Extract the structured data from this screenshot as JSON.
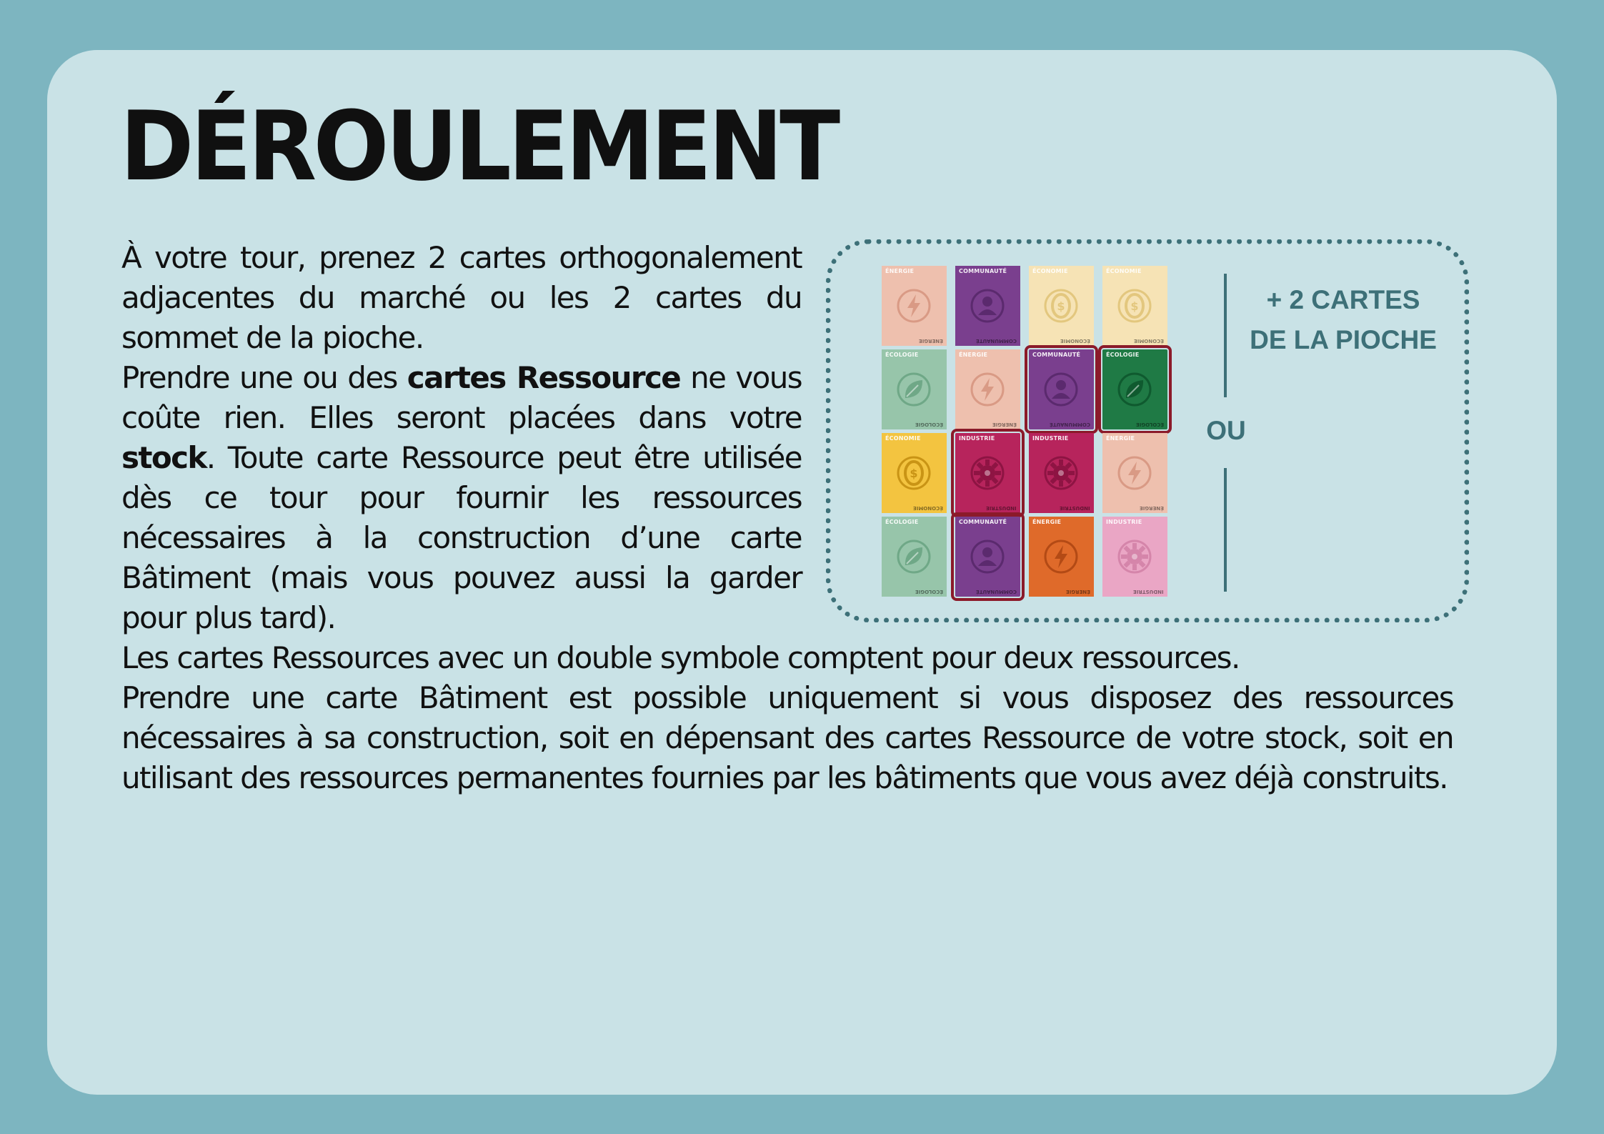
{
  "title": "DÉROULEMENT",
  "paragraph1": {
    "s1": "À votre tour, prenez 2 cartes orthogonalement adjacentes du marché ou les 2 cartes du sommet de la pioche.",
    "s2a": "Prendre une ou des ",
    "s2b": "cartes Ressource",
    "s2c": " ne vous coûte rien. Elles seront placées dans votre ",
    "s2d": "stock",
    "s2e": ". Toute carte Ressource peut être utilisée dès ce tour pour fournir les ressources nécessaires à la construction d’une carte Bâtiment (mais vous pouvez aussi la garder pour plus tard)."
  },
  "paragraph2": {
    "s1": "Les cartes Ressources avec un double symbole comptent pour deux ressources.",
    "s2": "Prendre une carte Bâtiment est possible uniquement si vous disposez des ressources nécessaires à sa construction, soit en dépensant des cartes Ressource de votre stock, soit en utilisant des ressources permanentes fournies par les bâtiments que vous avez déjà construits."
  },
  "diagram": {
    "or_label": "OU",
    "draw_label_line1": "+ 2 CARTES",
    "draw_label_line2": "DE LA PIOCHE",
    "cards": [
      {
        "label": "ÉNERGIE",
        "icon": "lightning-icon",
        "bg": "#eec0ae",
        "fg": "#d99a85",
        "selected": false
      },
      {
        "label": "COMMUNAUTÉ",
        "icon": "person-icon",
        "bg": "#7a3f8e",
        "fg": "#5b2a6e",
        "selected": false
      },
      {
        "label": "ÉCONOMIE",
        "icon": "coin-icon",
        "bg": "#f6e3b5",
        "fg": "#e3c77e",
        "selected": false
      },
      {
        "label": "ÉCONOMIE",
        "icon": "coin-icon",
        "bg": "#f6e3b5",
        "fg": "#e3c77e",
        "selected": false
      },
      {
        "label": "ÉCOLOGIE",
        "icon": "leaf-icon",
        "bg": "#97c5aa",
        "fg": "#6fa887",
        "selected": false
      },
      {
        "label": "ÉNERGIE",
        "icon": "lightning-icon",
        "bg": "#eec0ae",
        "fg": "#d99a85",
        "selected": false
      },
      {
        "label": "COMMUNAUTÉ",
        "icon": "person-icon",
        "bg": "#7a3f8e",
        "fg": "#5b2a6e",
        "selected": true
      },
      {
        "label": "ÉCOLOGIE",
        "icon": "leaf-icon",
        "bg": "#1f7a45",
        "fg": "#0f5a2f",
        "selected": true
      },
      {
        "label": "ÉCONOMIE",
        "icon": "coin-icon",
        "bg": "#f3c440",
        "fg": "#c99415",
        "selected": false
      },
      {
        "label": "INDUSTRIE",
        "icon": "gear-icon",
        "bg": "#b7245c",
        "fg": "#8e1443",
        "selected": true
      },
      {
        "label": "INDUSTRIE",
        "icon": "gear-icon",
        "bg": "#b7245c",
        "fg": "#8e1443",
        "selected": false
      },
      {
        "label": "ÉNERGIE",
        "icon": "lightning-icon",
        "bg": "#eec0ae",
        "fg": "#d99a85",
        "selected": false
      },
      {
        "label": "ÉCOLOGIE",
        "icon": "leaf-icon",
        "bg": "#97c5aa",
        "fg": "#6fa887",
        "selected": false
      },
      {
        "label": "COMMUNAUTÉ",
        "icon": "person-icon",
        "bg": "#7a3f8e",
        "fg": "#5b2a6e",
        "selected": true
      },
      {
        "label": "ÉNERGIE",
        "icon": "lightning-icon",
        "bg": "#df6a2a",
        "fg": "#b34a15",
        "selected": false
      },
      {
        "label": "INDUSTRIE",
        "icon": "gear-icon",
        "bg": "#eaa6c5",
        "fg": "#d585aa",
        "selected": false
      }
    ]
  }
}
